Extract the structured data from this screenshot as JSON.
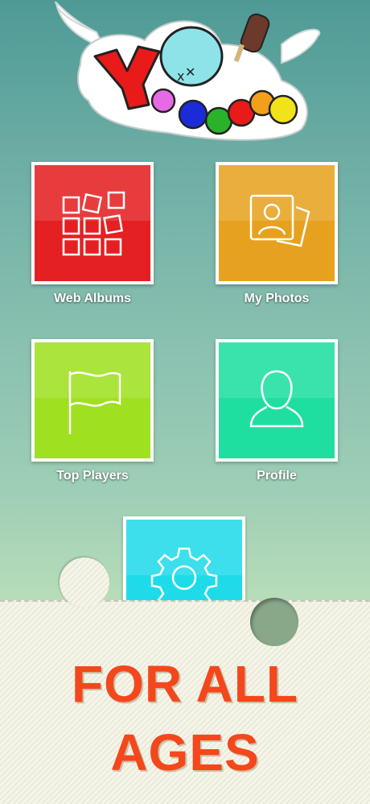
{
  "app": {
    "logo_text": "YoPuzzle"
  },
  "menu": {
    "web_albums": "Web Albums",
    "my_photos": "My Photos",
    "top_players": "Top Players",
    "profile": "Profile",
    "settings_icon": "gear-icon"
  },
  "tagline": {
    "line1": "FOR ALL",
    "line2": "AGES"
  },
  "colors": {
    "web_albums": "#e42022",
    "my_photos": "#e6a21e",
    "top_players": "#9fe020",
    "profile": "#1edfa0",
    "settings": "#1fdbe9",
    "tagline": "#f4471c"
  }
}
